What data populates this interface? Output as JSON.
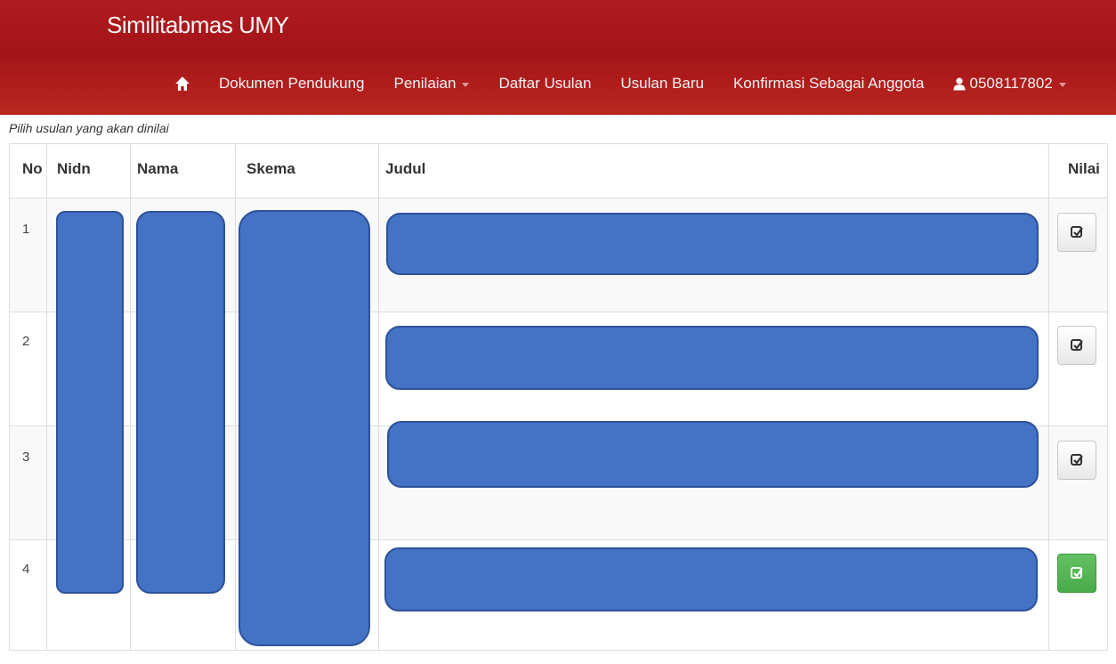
{
  "app": {
    "title": "Similitabmas UMY"
  },
  "nav": {
    "home_icon": "home-icon",
    "items": [
      {
        "label": "Dokumen Pendukung",
        "dropdown": false
      },
      {
        "label": "Penilaian",
        "dropdown": true
      },
      {
        "label": "Daftar Usulan",
        "dropdown": false
      },
      {
        "label": "Usulan Baru",
        "dropdown": false
      },
      {
        "label": "Konfirmasi Sebagai Anggota",
        "dropdown": false
      }
    ],
    "user": {
      "icon": "user-icon",
      "label": "0508117802",
      "dropdown": true
    }
  },
  "hint": "Pilih usulan yang akan dinilai",
  "table": {
    "headers": [
      "No",
      "Nidn",
      "Nama",
      "Skema",
      "Judul",
      "Nilai"
    ],
    "rows": [
      {
        "no": "1",
        "nilai_button": "check-icon",
        "state": "default"
      },
      {
        "no": "2",
        "nilai_button": "check-icon",
        "state": "default"
      },
      {
        "no": "3",
        "nilai_button": "check-icon",
        "state": "default"
      },
      {
        "no": "4",
        "nilai_button": "check-icon",
        "state": "success"
      }
    ]
  },
  "colors": {
    "navbar": "#a41418",
    "redaction": "#4472c4",
    "success_button": "#5cb85c"
  }
}
